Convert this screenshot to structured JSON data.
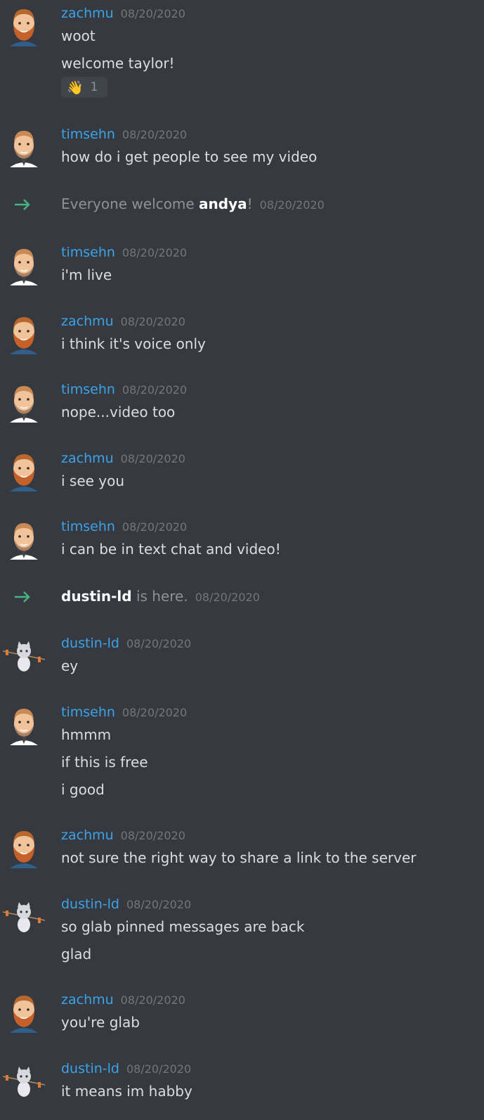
{
  "colors": {
    "background": "#36393f",
    "username": "#3ba3e8",
    "timestamp": "#72767d",
    "text": "#dcddde",
    "join_arrow": "#43b581"
  },
  "messages": [
    {
      "author": "zachmu",
      "timestamp": "08/20/2020",
      "avatar": "bearded-man-avatar",
      "lines": [
        "woot",
        "welcome taylor!"
      ],
      "reaction": {
        "emoji": "👋",
        "count": "1"
      }
    },
    {
      "author": "timsehn",
      "timestamp": "08/20/2020",
      "avatar": "man-avatar",
      "lines": [
        "how do i get people to see my video"
      ]
    },
    {
      "author": "timsehn",
      "timestamp": "08/20/2020",
      "avatar": "man-avatar",
      "lines": [
        "i'm live"
      ]
    },
    {
      "author": "zachmu",
      "timestamp": "08/20/2020",
      "avatar": "bearded-man-avatar",
      "lines": [
        "i think it's voice only"
      ]
    },
    {
      "author": "timsehn",
      "timestamp": "08/20/2020",
      "avatar": "man-avatar",
      "lines": [
        "nope...video too"
      ]
    },
    {
      "author": "zachmu",
      "timestamp": "08/20/2020",
      "avatar": "bearded-man-avatar",
      "lines": [
        "i see you"
      ]
    },
    {
      "author": "timsehn",
      "timestamp": "08/20/2020",
      "avatar": "man-avatar",
      "lines": [
        "i can be in text chat and video!"
      ]
    },
    {
      "author": "dustin-ld",
      "timestamp": "08/20/2020",
      "avatar": "cat-avatar",
      "lines": [
        "ey"
      ]
    },
    {
      "author": "timsehn",
      "timestamp": "08/20/2020",
      "avatar": "man-avatar",
      "lines": [
        "hmmm",
        "if this is free",
        "i good"
      ]
    },
    {
      "author": "zachmu",
      "timestamp": "08/20/2020",
      "avatar": "bearded-man-avatar",
      "lines": [
        "not sure the right way to share a link to the server"
      ]
    },
    {
      "author": "dustin-ld",
      "timestamp": "08/20/2020",
      "avatar": "cat-avatar",
      "lines": [
        "so glab pinned messages are back",
        "glad"
      ]
    },
    {
      "author": "zachmu",
      "timestamp": "08/20/2020",
      "avatar": "bearded-man-avatar",
      "lines": [
        "you're glab"
      ]
    },
    {
      "author": "dustin-ld",
      "timestamp": "08/20/2020",
      "avatar": "cat-avatar",
      "lines": [
        "it means im habby"
      ]
    }
  ],
  "system": [
    {
      "before": "Everyone welcome ",
      "name": "andya",
      "after": "!",
      "timestamp": "08/20/2020",
      "icon": "join-arrow-icon"
    },
    {
      "before": "",
      "name": "dustin-ld",
      "after": " is here.",
      "timestamp": "08/20/2020",
      "icon": "join-arrow-icon"
    }
  ]
}
